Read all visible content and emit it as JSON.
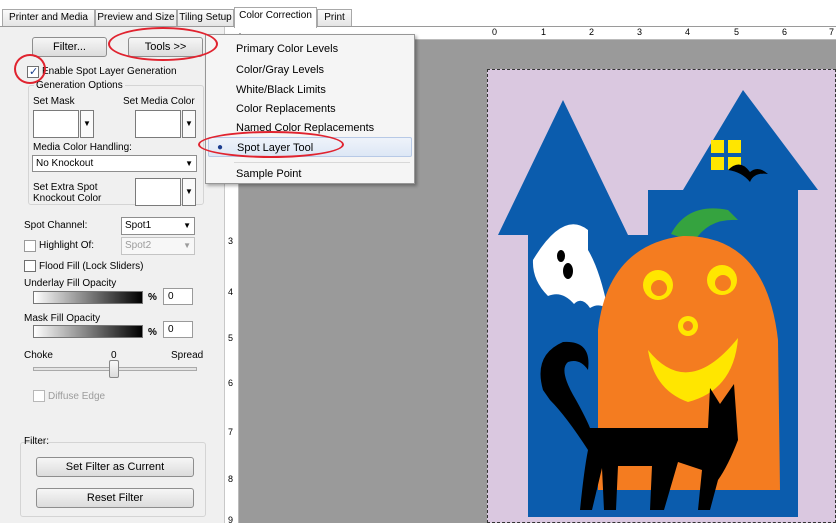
{
  "tabs": [
    {
      "label": "Printer and Media",
      "active": false
    },
    {
      "label": "Preview and Size",
      "active": false
    },
    {
      "label": "Tiling Setup",
      "active": false
    },
    {
      "label": "Color Correction",
      "active": true
    },
    {
      "label": "Print",
      "active": false
    }
  ],
  "panel": {
    "filter_button": "Filter...",
    "tools_button": "Tools >>",
    "enable_spot_label": "Enable Spot Layer Generation",
    "enable_spot_checked": true,
    "generation_options_label": "Generation Options",
    "set_mask_label": "Set Mask",
    "set_media_color_label": "Set Media Color",
    "media_color_handling_label": "Media Color Handling:",
    "media_color_handling_value": "No Knockout",
    "set_extra_spot_label_1": "Set Extra Spot",
    "set_extra_spot_label_2": "Knockout Color",
    "spot_channel_label": "Spot Channel:",
    "spot_channel_value": "Spot1",
    "highlight_of_label": "Highlight Of:",
    "highlight_of_value": "Spot2",
    "flood_fill_label": "Flood Fill (Lock Sliders)",
    "underlay_label": "Underlay Fill Opacity",
    "underlay_value": "0",
    "mask_fill_label": "Mask Fill Opacity",
    "mask_fill_value": "0",
    "percent_sign": "%",
    "choke_label": "Choke",
    "choke_value": "0",
    "spread_label": "Spread",
    "diffuse_edge_label": "Diffuse Edge",
    "filter_group_label": "Filter:",
    "set_filter_button": "Set Filter as Current",
    "reset_filter_button": "Reset Filter"
  },
  "tools_menu": {
    "items": [
      {
        "label": "Primary Color Levels"
      },
      {
        "label": "Color/Gray Levels"
      },
      {
        "label": "White/Black Limits"
      },
      {
        "label": "Color Replacements"
      },
      {
        "label": "Named Color Replacements"
      },
      {
        "label": "Spot Layer Tool",
        "selected": true
      },
      {
        "label": "Sample Point"
      }
    ]
  },
  "rulers": {
    "top_numbers": [
      "0",
      "1",
      "2",
      "3",
      "4",
      "5",
      "6",
      "7"
    ],
    "left_numbers": [
      "3",
      "4",
      "5",
      "6",
      "7",
      "8",
      "9"
    ]
  },
  "colors": {
    "accent_red": "#e0232f",
    "media_background": "#dac8e0",
    "house_blue": "#0b5cad",
    "pumpkin_orange": "#f47c20",
    "face_yellow": "#ffe600",
    "stem_green": "#35a33f",
    "canvas_gray": "#9a9a9a"
  }
}
